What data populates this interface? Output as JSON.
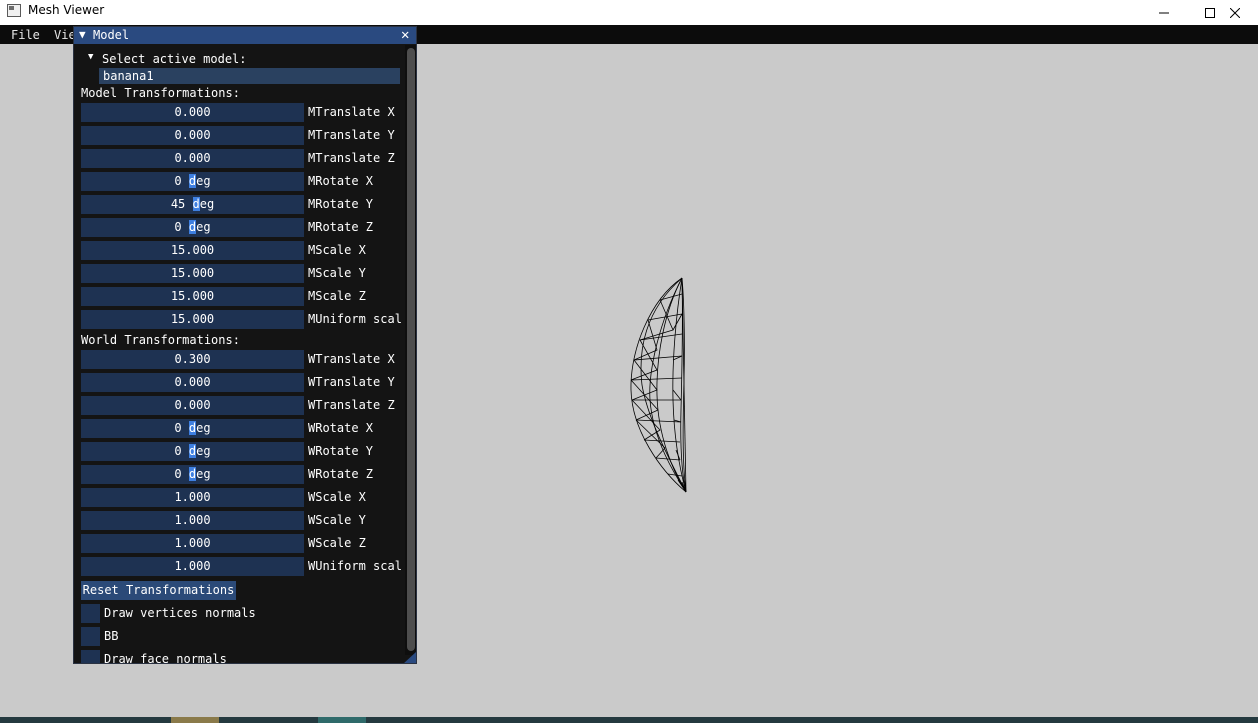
{
  "window": {
    "title": "Mesh Viewer",
    "controls": {
      "minimize": "minimize",
      "maximize": "maximize",
      "close": "close"
    }
  },
  "menubar": {
    "items": [
      "File",
      "Vie"
    ]
  },
  "panel": {
    "title": "Model",
    "close_symbol": "✕",
    "collapse_symbol": "▼",
    "select_label": "Select active model:",
    "select_arrow": "▼",
    "selected_model": "banana1",
    "model_section_label": "Model Transformations:",
    "model_rows": [
      {
        "value": "0.000",
        "label": "MTranslate X"
      },
      {
        "value": "0.000",
        "label": "MTranslate Y"
      },
      {
        "value": "0.000",
        "label": "MTranslate Z"
      },
      {
        "value": "0 deg",
        "label": "MRotate X"
      },
      {
        "value": "45 deg",
        "label": "MRotate Y"
      },
      {
        "value": "0 deg",
        "label": "MRotate Z"
      },
      {
        "value": "15.000",
        "label": "MScale X"
      },
      {
        "value": "15.000",
        "label": "MScale Y"
      },
      {
        "value": "15.000",
        "label": "MScale Z"
      },
      {
        "value": "15.000",
        "label": "MUniform scal"
      }
    ],
    "world_section_label": "World Transformations:",
    "world_rows": [
      {
        "value": "0.300",
        "label": "WTranslate X"
      },
      {
        "value": "0.000",
        "label": "WTranslate Y"
      },
      {
        "value": "0.000",
        "label": "WTranslate Z"
      },
      {
        "value": "0 deg",
        "label": "WRotate X"
      },
      {
        "value": "0 deg",
        "label": "WRotate Y"
      },
      {
        "value": "0 deg",
        "label": "WRotate Z"
      },
      {
        "value": "1.000",
        "label": "WScale X"
      },
      {
        "value": "1.000",
        "label": "WScale Y"
      },
      {
        "value": "1.000",
        "label": "WScale Z"
      },
      {
        "value": "1.000",
        "label": "WUniform scal"
      }
    ],
    "reset_label": "Reset Transformations",
    "checkboxes": [
      {
        "label": "Draw vertices normals",
        "checked": false
      },
      {
        "label": "BB",
        "checked": false
      },
      {
        "label": "Draw face normals",
        "checked": false
      }
    ]
  },
  "colors": {
    "viewport_bg": "#cacaca",
    "panel_bg": "#141414",
    "title_active": "#2a4a80",
    "frame_bg": "#1e3252",
    "selection": "#3e7fe0",
    "mesh_line": "#000000"
  }
}
